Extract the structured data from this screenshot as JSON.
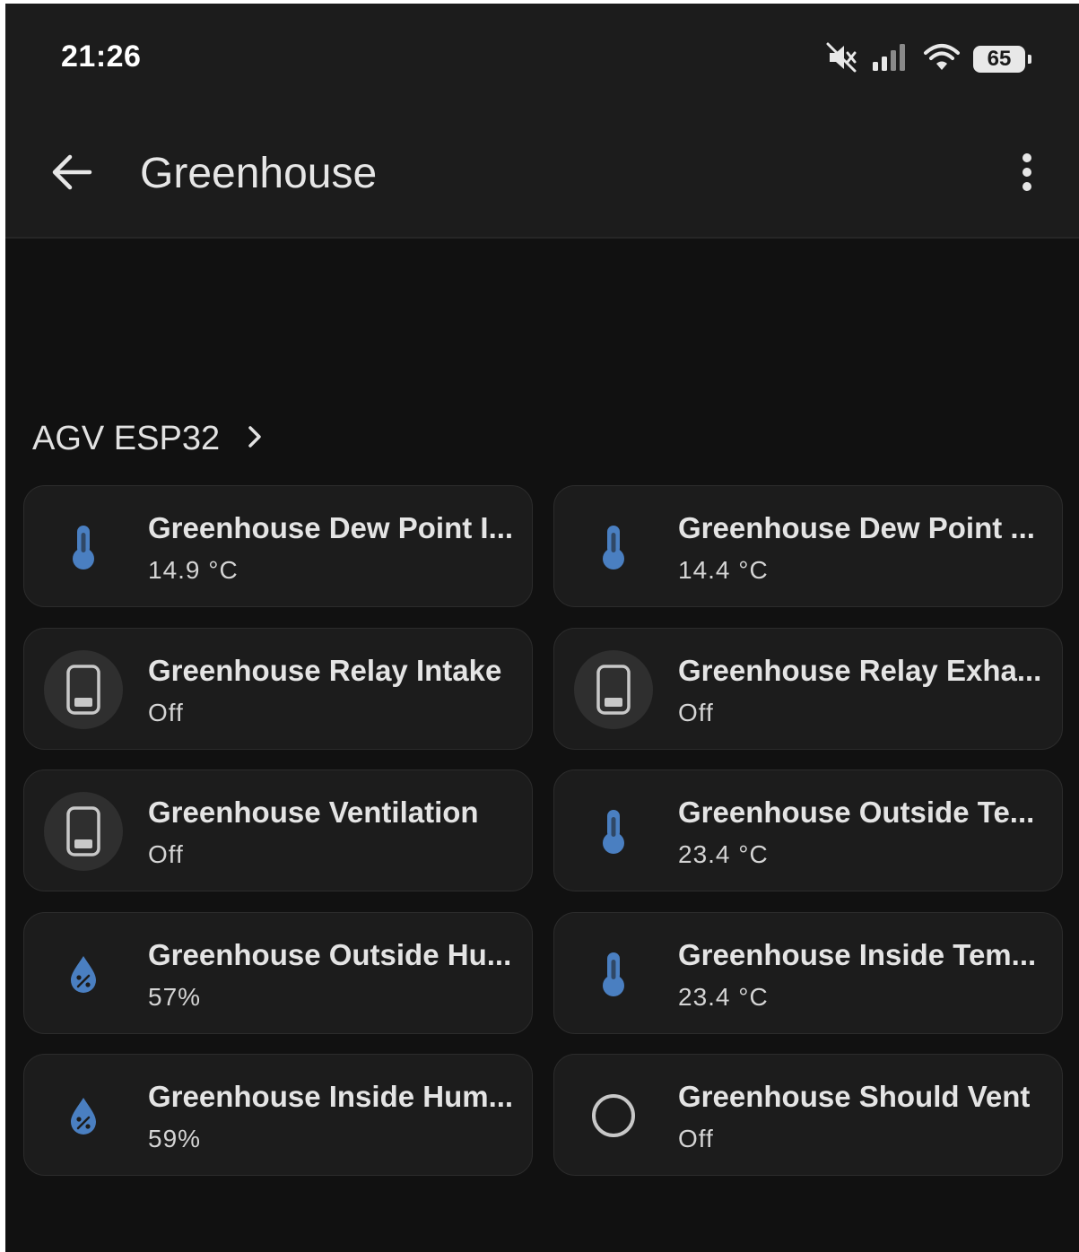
{
  "status_bar": {
    "time": "21:26",
    "battery": "65",
    "icons": [
      "mute-icon",
      "signal-icon",
      "wifi-icon",
      "battery-icon"
    ]
  },
  "app_bar": {
    "title": "Greenhouse",
    "back_icon": "arrow-left-icon",
    "menu_icon": "more-vertical-icon"
  },
  "section": {
    "title": "AGV ESP32",
    "chevron_icon": "chevron-right-icon"
  },
  "entities": [
    {
      "name": "Greenhouse Dew Point I...",
      "state": "14.9 °C",
      "icon": "thermometer-icon"
    },
    {
      "name": "Greenhouse Dew Point ...",
      "state": "14.4 °C",
      "icon": "thermometer-icon"
    },
    {
      "name": "Greenhouse Relay Intake",
      "state": "Off",
      "icon": "switch-off-icon"
    },
    {
      "name": "Greenhouse Relay Exha...",
      "state": "Off",
      "icon": "switch-off-icon"
    },
    {
      "name": "Greenhouse Ventilation",
      "state": "Off",
      "icon": "switch-off-icon"
    },
    {
      "name": "Greenhouse Outside Te...",
      "state": "23.4 °C",
      "icon": "thermometer-icon"
    },
    {
      "name": "Greenhouse Outside Hu...",
      "state": "57%",
      "icon": "humidity-icon"
    },
    {
      "name": "Greenhouse Inside Tem...",
      "state": "23.4 °C",
      "icon": "thermometer-icon"
    },
    {
      "name": "Greenhouse Inside Hum...",
      "state": "59%",
      "icon": "humidity-icon"
    },
    {
      "name": "Greenhouse Should Vent",
      "state": "Off",
      "icon": "circle-outline-icon"
    }
  ],
  "colors": {
    "accent": "#4a7fc1",
    "background": "#111111",
    "card": "#1c1c1c",
    "app_bar": "#1c1c1c"
  }
}
